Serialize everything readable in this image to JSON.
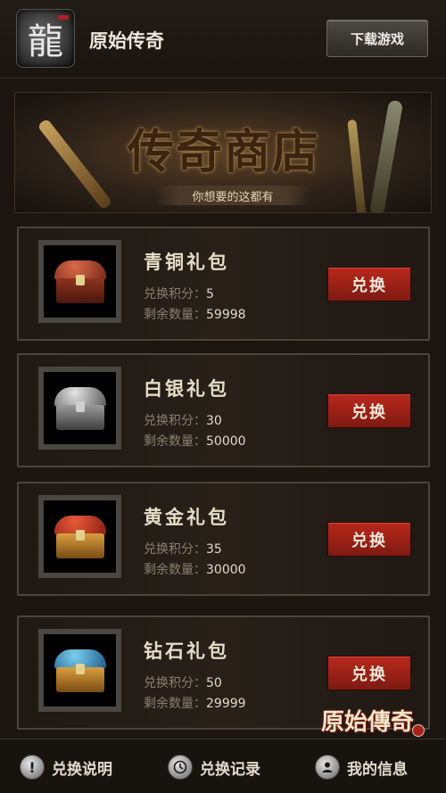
{
  "header": {
    "logo_glyph": "龍",
    "title": "原始传奇",
    "download_label": "下载游戏"
  },
  "banner": {
    "title": "传奇商店",
    "subtitle": "你想要的这都有"
  },
  "labels": {
    "points": "兑换积分：",
    "remaining": "剩余数量：",
    "exchange": "兑换"
  },
  "items": [
    {
      "name": "青铜礼包",
      "points": "5",
      "remaining": "59998",
      "chest_color": "#a8432a"
    },
    {
      "name": "白银礼包",
      "points": "30",
      "remaining": "50000",
      "chest_color": "#8c8c8c"
    },
    {
      "name": "黄金礼包",
      "points": "35",
      "remaining": "30000",
      "chest_color": "#c9923a"
    },
    {
      "name": "钻石礼包",
      "points": "50",
      "remaining": "29999",
      "chest_color": "#3a8ac0"
    }
  ],
  "footer": {
    "rules_label": "兑换说明",
    "records_label": "兑换记录",
    "profile_label": "我的信息"
  },
  "watermark": "原始傳奇"
}
